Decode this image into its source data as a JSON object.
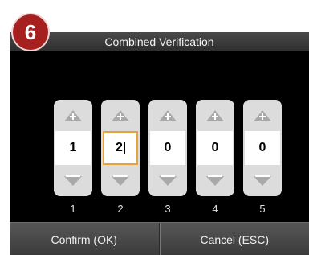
{
  "badge": {
    "number": "6",
    "color": "#a6201f"
  },
  "dialog": {
    "title": "Combined Verification",
    "digits": [
      {
        "value": "1",
        "label": "1",
        "active": false
      },
      {
        "value": "2",
        "label": "2",
        "active": true
      },
      {
        "value": "0",
        "label": "3",
        "active": false
      },
      {
        "value": "0",
        "label": "4",
        "active": false
      },
      {
        "value": "0",
        "label": "5",
        "active": false
      }
    ],
    "icons": {
      "increment": "up-arrow-icon",
      "decrement": "down-arrow-icon"
    },
    "confirm_label": "Confirm (OK)",
    "cancel_label": "Cancel (ESC)"
  },
  "colors": {
    "highlight_border": "#e8a23a",
    "screen_background": "#000000",
    "spinner_background": "#dcdcdc"
  }
}
